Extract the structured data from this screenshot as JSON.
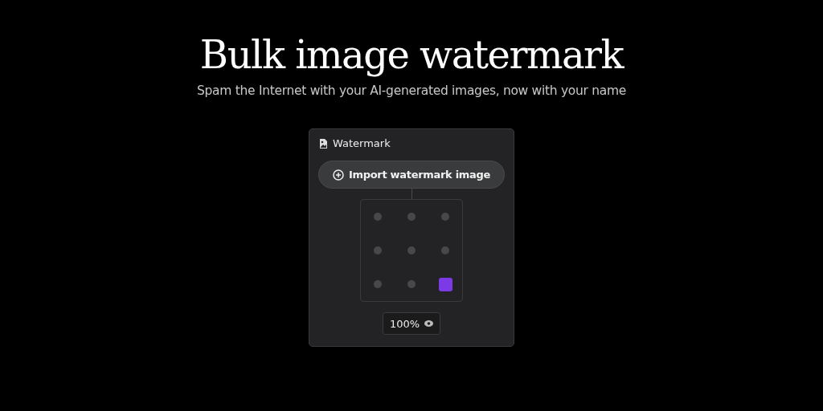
{
  "title": "Bulk image watermark",
  "subtitle": "Spam the Internet with your AI-generated images, now with your name",
  "panel": {
    "title": "Watermark",
    "import_button": "Import watermark image",
    "positions": [
      {
        "selected": false
      },
      {
        "selected": false
      },
      {
        "selected": false
      },
      {
        "selected": false
      },
      {
        "selected": false
      },
      {
        "selected": false
      },
      {
        "selected": false
      },
      {
        "selected": false
      },
      {
        "selected": true
      }
    ],
    "opacity": "100%"
  }
}
